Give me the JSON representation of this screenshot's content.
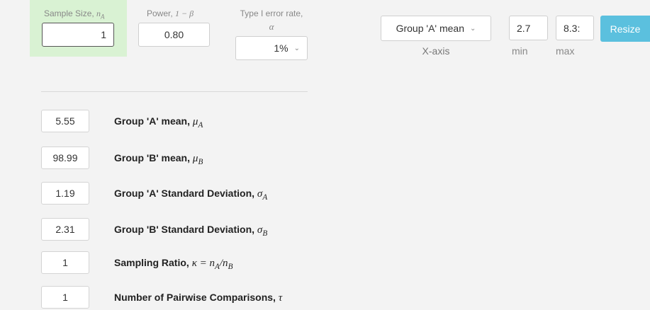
{
  "top_controls": {
    "sample_size": {
      "label": "Sample Size,",
      "symbol": "n",
      "sub": "A",
      "value": "1"
    },
    "power": {
      "label": "Power,",
      "symbol": "1 − β",
      "value": "0.80"
    },
    "alpha": {
      "label_line1": "Type I error rate,",
      "symbol": "α",
      "selected": "1%"
    },
    "x_axis": {
      "selected": "Group 'A' mean",
      "caption": "X-axis"
    },
    "range": {
      "min_value": "2.7",
      "max_value": "8.3:",
      "min_caption": "min",
      "max_caption": "max"
    },
    "resize_label": "Resize"
  },
  "params": [
    {
      "value": "5.55",
      "label": "Group 'A' mean,",
      "sym": "μ",
      "sub": "A"
    },
    {
      "value": "98.99",
      "label": "Group 'B' mean,",
      "sym": "μ",
      "sub": "B"
    },
    {
      "value": "1.19",
      "label": "Group 'A' Standard Deviation,",
      "sym": "σ",
      "sub": "A"
    },
    {
      "value": "2.31",
      "label": "Group 'B' Standard Deviation,",
      "sym": "σ",
      "sub": "B"
    },
    {
      "value": "1",
      "label": "Sampling Ratio,",
      "sym": "κ = n",
      "sub": "A",
      "tail": "/n",
      "tail_sub": "B"
    },
    {
      "value": "1",
      "label": "Number of Pairwise Comparisons,",
      "sym": "τ"
    }
  ]
}
